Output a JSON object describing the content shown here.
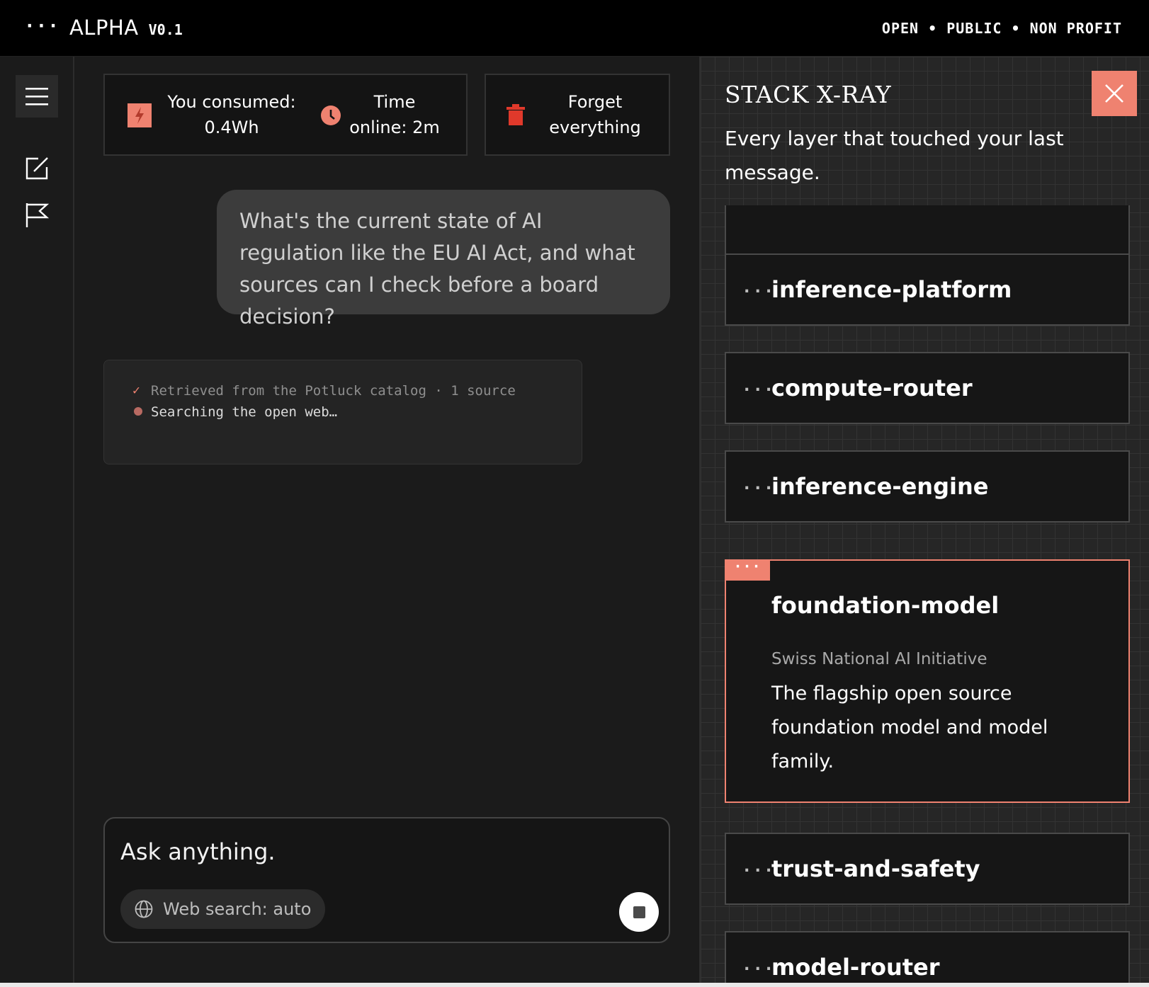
{
  "header": {
    "brand_dots": "···",
    "brand_name": "ALPHA",
    "version": "V0.1",
    "tagline": "OPEN • PUBLIC • NON PROFIT"
  },
  "rail": {
    "icons": [
      "menu-icon",
      "new-chat-icon",
      "flag-icon"
    ]
  },
  "stats": {
    "consumed_label": "You consumed:",
    "consumed_value": "0.4Wh",
    "time_label": "Time",
    "time_value": "online: 2m",
    "forget_line1": "Forget",
    "forget_line2": "everything"
  },
  "chat": {
    "user_message": "What's the current state of AI regulation like the EU AI Act, and what sources can I check before a board decision?",
    "status": {
      "done_mark": "✓",
      "done_text": "Retrieved from the Potluck catalog · 1 source",
      "active_text": "Searching the open web…"
    }
  },
  "composer": {
    "placeholder": "Ask anything.",
    "web_search_label": "Web search: auto"
  },
  "panel": {
    "title": "STACK X-RAY",
    "subtitle": "Every layer that touched your last message.",
    "layers": [
      {
        "name": "inference-platform"
      },
      {
        "name": "compute-router"
      },
      {
        "name": "inference-engine"
      }
    ],
    "expanded": {
      "tab": "···",
      "name": "foundation-model",
      "org": "Swiss National AI Initiative",
      "description": "The flagship open source foundation model and model family."
    },
    "layers_after": [
      {
        "name": "trust-and-safety"
      },
      {
        "name": "model-router"
      }
    ]
  },
  "colors": {
    "accent": "#ef8270",
    "trash": "#e0392b",
    "background": "#1b1b1b",
    "topbar": "#000000"
  }
}
